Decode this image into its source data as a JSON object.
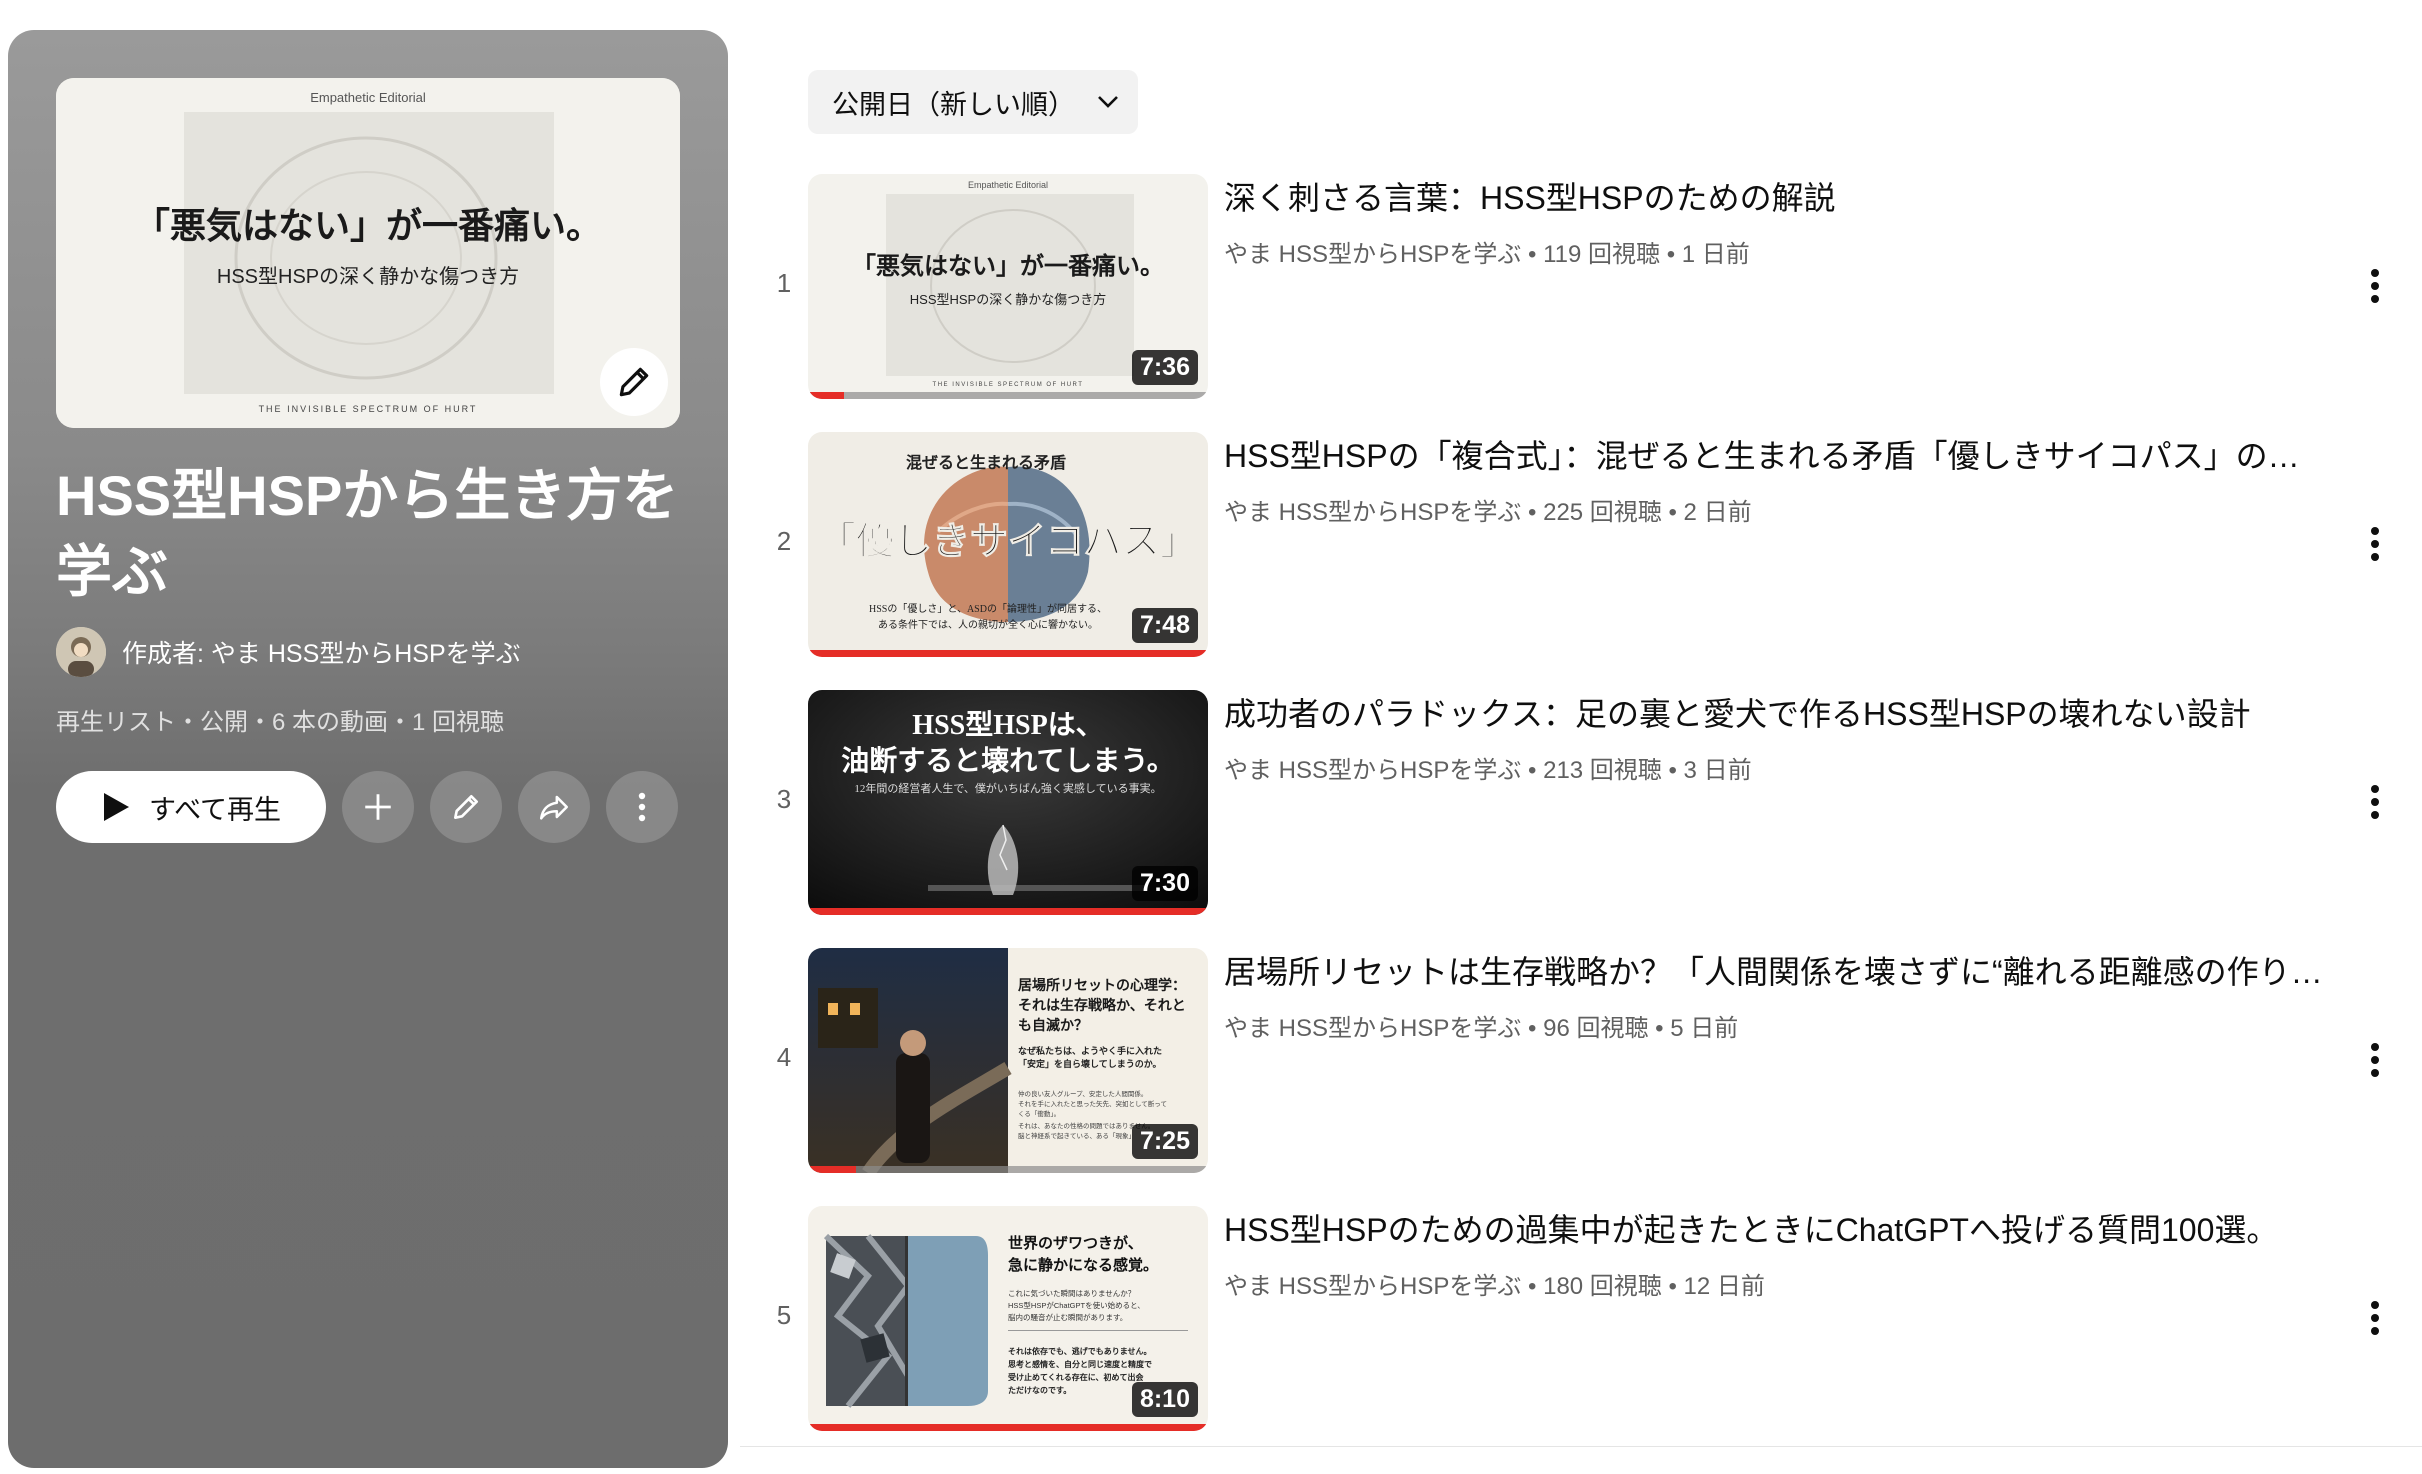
{
  "playlist": {
    "title": "HSS型HSPから生き方を学ぶ",
    "creator": "作成者: やま HSS型からHSPを学ぶ",
    "meta": "再生リスト・公開・6 本の動画・1 回視聴",
    "play_all": "すべて再生",
    "thumb": {
      "brand": "Empathetic Editorial",
      "headline": "「悪気はない」が一番痛い。",
      "sub": "HSS型HSPの深く静かな傷つき方",
      "footer": "THE INVISIBLE SPECTRUM OF HURT"
    }
  },
  "sort": {
    "label": "公開日（新しい順）"
  },
  "videos": [
    {
      "index": "1",
      "title": "深く刺さる言葉：HSS型HSPのための解説",
      "meta": "やま HSS型からHSPを学ぶ • 119 回視聴 • 1 日前",
      "duration": "7:36",
      "progress": 0.09,
      "thumb": {
        "brand": "Empathetic Editorial",
        "headline": "「悪気はない」が一番痛い。",
        "sub": "HSS型HSPの深く静かな傷つき方",
        "footer": "THE INVISIBLE SPECTRUM OF HURT"
      }
    },
    {
      "index": "2",
      "title": "HSS型HSPの「複合式」：混ぜると生まれる矛盾「優しきサイコパス」の正体…",
      "meta": "やま HSS型からHSPを学ぶ • 225 回視聴 • 2 日前",
      "duration": "7:48",
      "progress": 1.0,
      "thumb": {
        "top": "混ぜると生まれる矛盾",
        "headline": "「優しきサイコパス」",
        "line1": "HSSの「優しさ」と、ASDの「論理性」が同居する、",
        "line2": "ある条件下では、人の親切が全く心に響かない。"
      }
    },
    {
      "index": "3",
      "title": "成功者のパラドックス：足の裏と愛犬で作るHSS型HSPの壊れない設計",
      "meta": "やま HSS型からHSPを学ぶ • 213 回視聴 • 3 日前",
      "duration": "7:30",
      "progress": 1.0,
      "thumb": {
        "line1": "HSS型HSPは、",
        "line2": "油断すると壊れてしまう。",
        "sub": "12年間の経営者人生で、僕がいちばん強く実感している事実。"
      }
    },
    {
      "index": "4",
      "title": "居場所リセットは生存戦略か？「人間関係を壊さずに“離れる距離感の作り…",
      "meta": "やま HSS型からHSPを学ぶ • 96 回視聴 • 5 日前",
      "duration": "7:25",
      "progress": 0.12,
      "thumb": {
        "h1": "居場所リセットの心理学：",
        "h2": "それは生存戦略か、それと",
        "h3": "も自滅か？",
        "b1": "なぜ私たちは、ようやく手に入れた",
        "b2": "「安定」を自ら壊してしまうのか。",
        "s1": "仲の良い友人グループ、安定した人間関係。",
        "s2": "それを手に入れたと思った矢先、突如として断って",
        "s3": "くる「衝動」。",
        "s4": "それは、あなたの性格の問題ではありません。",
        "s5": "脳と神経系で起きている、ある「現象」"
      }
    },
    {
      "index": "5",
      "title": "HSS型HSPのための過集中が起きたときにChatGPTへ投げる質問100選。",
      "meta": "やま HSS型からHSPを学ぶ • 180 回視聴 • 12 日前",
      "duration": "8:10",
      "progress": 1.0,
      "thumb": {
        "h1": "世界のザワつきが、",
        "h2": "急に静かになる感覚。",
        "b1": "これに気づいた瞬間はありませんか？",
        "b2": "HSS型HSPがChatGPTを使い始めると、",
        "b3": "脳内の騒音が止む瞬間があります。",
        "c1": "それは依存でも、逃げでもありません。",
        "c2": "思考と感情を、自分と同じ速度と精度で",
        "c3": "受け止めてくれる存在に、初めて出会",
        "c4": "ただけなのです。"
      }
    }
  ]
}
